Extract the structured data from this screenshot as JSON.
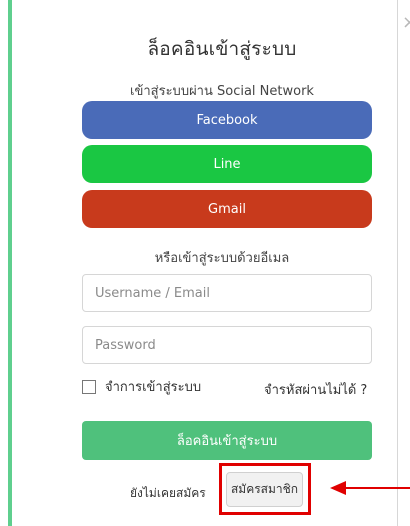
{
  "modal": {
    "title": "ล็อคอินเข้าสู่ระบบ",
    "social_heading": "เข้าสู่ระบบผ่าน Social Network",
    "social_buttons": [
      {
        "label": "Facebook",
        "color": "#4a6bb8"
      },
      {
        "label": "Line",
        "color": "#1ac743"
      },
      {
        "label": "Gmail",
        "color": "#c83a1c"
      }
    ],
    "email_heading": "หรือเข้าสู่ระบบด้วยอีเมล",
    "username_placeholder": "Username / Email",
    "password_placeholder": "Password",
    "remember_label": "จำการเข้าสู่ระบบ",
    "forgot_label": "จำรหัสผ่านไม่ได้ ?",
    "login_label": "ล็อคอินเข้าสู่ระบบ",
    "no_account_text": "ยังไม่เคยสมัคร",
    "signup_label": "สมัครสมาชิก",
    "close_icon": "close-icon"
  },
  "colors": {
    "accent": "#4fc17c",
    "highlight": "#e00000"
  }
}
